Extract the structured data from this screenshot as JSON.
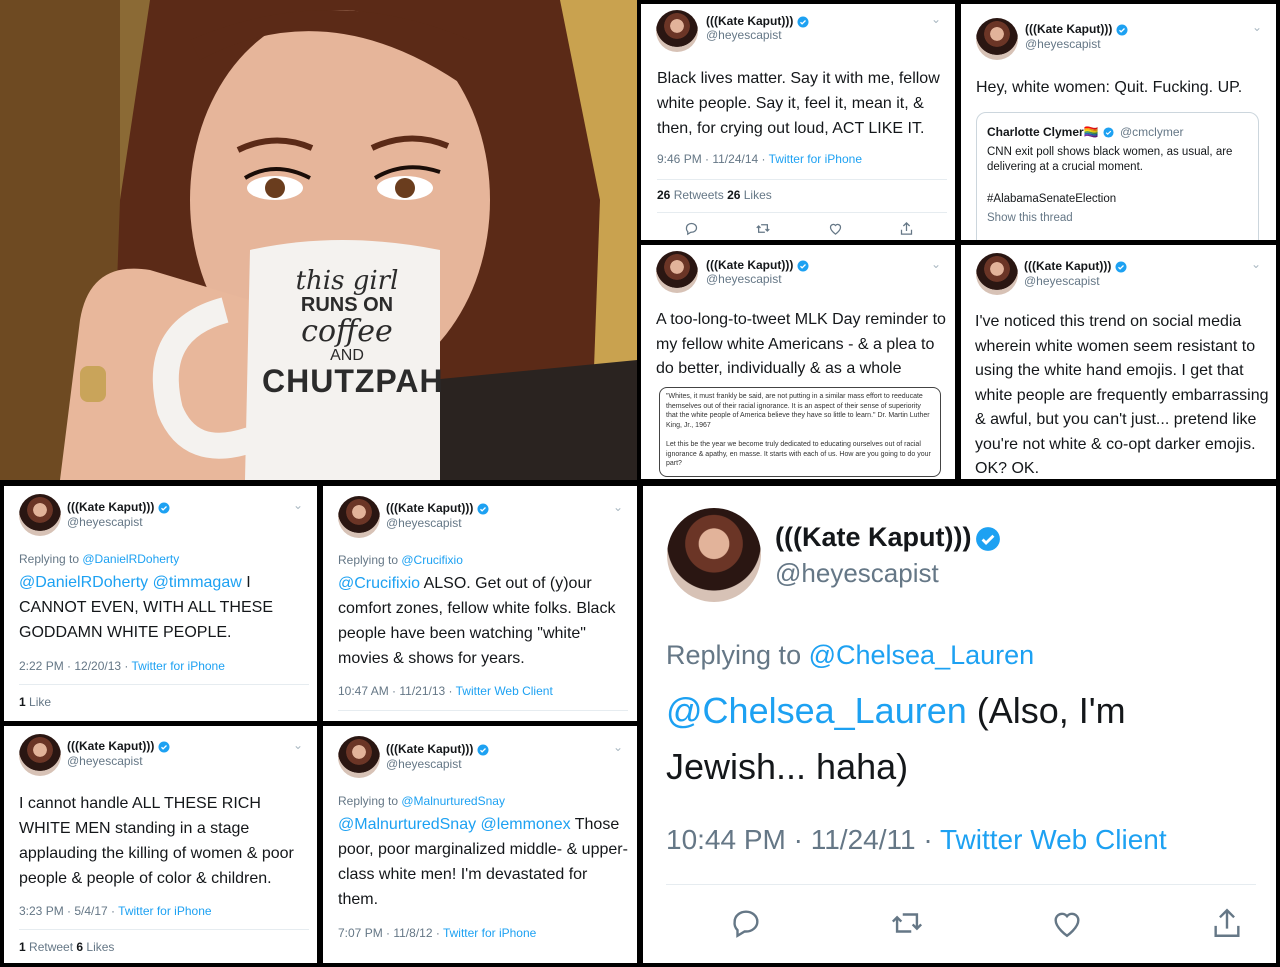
{
  "photo": {
    "mug_text": [
      "this girl",
      "RUNS ON",
      "coffee",
      "AND",
      "CHUTZPAH"
    ]
  },
  "user": {
    "name": "(((Kate Kaput)))",
    "handle": "@heyescapist"
  },
  "tweets": [
    {
      "id": "t1",
      "text": "Black lives matter. Say it with me, fellow white people. Say it, feel it, mean it, & then, for crying out loud, ACT LIKE IT.",
      "time": "9:46 PM · 11/24/14 · ",
      "client": "Twitter for iPhone",
      "retweets": "26",
      "retweets_label": " Retweets ",
      "likes": "26",
      "likes_label": " Likes"
    },
    {
      "id": "t2",
      "text": "Hey, white women: Quit. Fucking. UP.",
      "quote": {
        "name": "Charlotte Clymer🏳️‍🌈",
        "handle": "@cmclymer",
        "text": "CNN exit poll shows black women, as usual, are delivering at a crucial moment.",
        "tag": "#AlabamaSenateElection",
        "show": "Show this thread"
      }
    },
    {
      "id": "t3",
      "text": "A too-long-to-tweet MLK Day reminder to my fellow white Americans - & a plea to do better, individually & as a whole",
      "image_quote": "\"Whites, it must frankly be said, are not putting in a similar mass effort to reeducate themselves out of their racial ignorance. It is an aspect of their sense of superiority that the white people of America believe they have so little to learn.\" Dr. Martin Luther King, Jr., 1967",
      "image_text": "Let this be the year we become truly dedicated to educating ourselves out of racial ignorance & apathy, en masse. It starts with each of us. How are you going to do your part?"
    },
    {
      "id": "t4",
      "text": "I've noticed this trend on social media wherein white women seem resistant to using the white hand emojis. I get that white people are frequently embarrassing & awful, but you can't just... pretend like you're not white & co-opt darker emojis. OK? OK."
    },
    {
      "id": "t5",
      "replying_label": "Replying to ",
      "replying_to": "@DanielRDoherty",
      "mention1": "@DanielRDoherty",
      "mention2": " @timmagaw",
      "text": " I CANNOT EVEN, WITH ALL THESE GODDAMN WHITE PEOPLE.",
      "time": "2:22 PM · 12/20/13 · ",
      "client": "Twitter for iPhone",
      "likes": "1",
      "likes_label": " Like"
    },
    {
      "id": "t6",
      "replying_label": "Replying to ",
      "replying_to": "@Crucifixio",
      "mention1": "@Crucifixio",
      "text": " ALSO. Get out of (y)our comfort zones, fellow white folks. Black people have been watching \"white\" movies & shows for years.",
      "time": "10:47 AM · 11/21/13 · ",
      "client": "Twitter Web Client"
    },
    {
      "id": "t7",
      "text": "I cannot handle ALL THESE RICH WHITE MEN standing in a stage applauding the killing of women & poor people & people of color & children.",
      "time": "3:23 PM · 5/4/17 · ",
      "client": "Twitter for iPhone",
      "retweets": "1",
      "retweets_label": " Retweet ",
      "likes": "6",
      "likes_label": " Likes"
    },
    {
      "id": "t8",
      "replying_label": "Replying to ",
      "replying_to": "@MalnurturedSnay",
      "mention1": "@MalnurturedSnay",
      "mention2": " @lemmonex",
      "text": " Those poor, poor marginalized middle- & upper-class white men! I'm devastated for them.",
      "time": "7:07 PM · 11/8/12 · ",
      "client": "Twitter for iPhone"
    },
    {
      "id": "t9",
      "replying_label": "Replying to ",
      "replying_to": "@Chelsea_Lauren",
      "mention1": "@Chelsea_Lauren",
      "text": " (Also, I'm Jewish... haha)",
      "time": "10:44 PM · 11/24/11 · ",
      "client": "Twitter Web Client"
    }
  ],
  "icons": [
    "reply-icon",
    "retweet-icon",
    "like-icon",
    "share-icon",
    "verified-badge-icon",
    "chevron-down-icon"
  ],
  "colors": {
    "twitter_blue": "#1da1f2",
    "meta_gray": "#657786",
    "border": "#e6ecf0"
  }
}
